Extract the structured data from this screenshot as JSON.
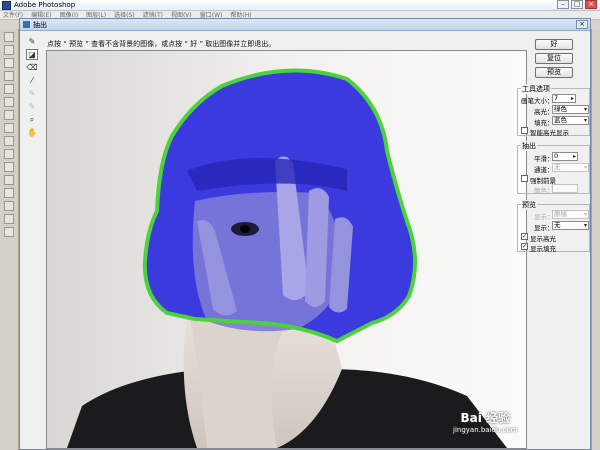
{
  "app": {
    "title": "Adobe Photoshop"
  },
  "menubar": [
    "文件(F)",
    "编辑(E)",
    "图像(I)",
    "图层(L)",
    "选择(S)",
    "滤镜(T)",
    "视图(V)",
    "窗口(W)",
    "帮助(H)"
  ],
  "dialog": {
    "title": "抽出",
    "instruction": "点按 “ 预览 ” 查看不含背景的图像，或点按 “ 好 ” 取出图像并立即退出。",
    "buttons": {
      "ok": "好",
      "reset": "复位",
      "preview": "预览"
    },
    "tool_options": {
      "title": "工具选项",
      "brush_size_label": "画笔大小：",
      "brush_size_value": "7",
      "highlight_label": "高光：",
      "highlight_value": "绿色",
      "fill_label": "填充：",
      "fill_value": "蓝色",
      "smart_highlight_label": "智能高光显示",
      "smart_highlight_checked": false
    },
    "extraction": {
      "title": "抽出",
      "smooth_label": "平滑：",
      "smooth_value": "0",
      "channel_label": "通道：",
      "channel_value": "无",
      "force_fg_label": "强制前景",
      "force_fg_checked": false,
      "color_label": "颜色："
    },
    "preview_group": {
      "title": "预览",
      "show_label": "显示：",
      "show_value": "原稿",
      "display_label": "显示：",
      "display_value": "无",
      "show_highlight_label": "显示高光",
      "show_highlight_checked": true,
      "show_fill_label": "显示填充",
      "show_fill_checked": true
    }
  },
  "watermark": {
    "brand": "Bai 经验",
    "url": "jingyan.baidu.com"
  },
  "colors": {
    "fill": "#3a3adf",
    "highlight": "#4cd23a",
    "dialog_bg": "#f0f0f0"
  },
  "icons": [
    "edge-highlighter-icon",
    "fill-icon",
    "eraser-icon",
    "eyedropper-icon",
    "cleanup-icon",
    "edge-touchup-icon",
    "zoom-icon",
    "hand-icon"
  ]
}
